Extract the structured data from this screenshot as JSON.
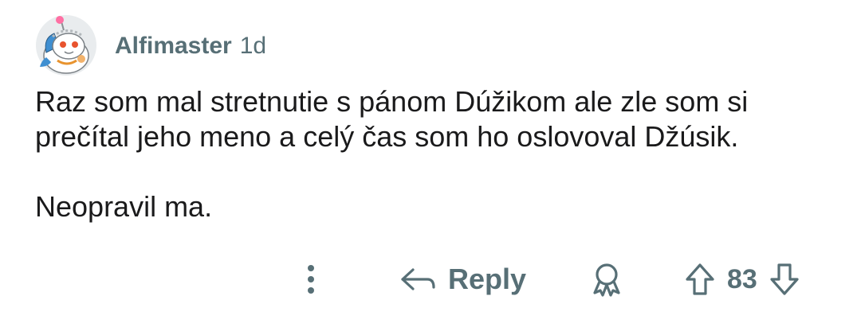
{
  "comment": {
    "author": "Alfimaster",
    "time": "1d",
    "body": [
      "Raz som mal stretnutie s pánom Dúžikom ale zle som si prečítal jeho meno a celý čas som ho oslovoval Džúsik.",
      "Neopravil ma."
    ],
    "avatar_icon": "snoo-avatar-icon"
  },
  "actions": {
    "more_icon": "more-vertical-icon",
    "reply_icon": "reply-arrow-icon",
    "reply_label": "Reply",
    "award_icon": "award-icon",
    "upvote_icon": "upvote-arrow-icon",
    "downvote_icon": "downvote-arrow-icon",
    "vote_count": "83"
  },
  "colors": {
    "text": "#1a1a1b",
    "meta": "#576f76",
    "background": "#ffffff"
  }
}
